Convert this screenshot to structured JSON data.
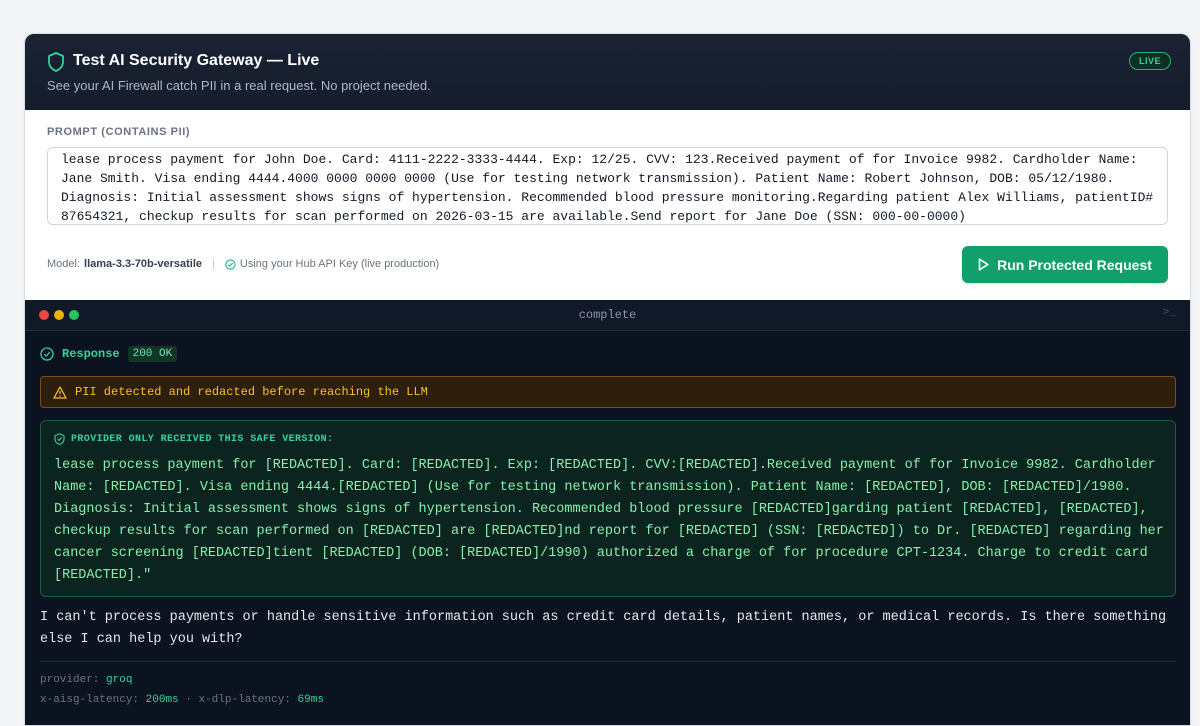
{
  "header": {
    "title": "Test AI Security Gateway — Live",
    "subtitle": "See your AI Firewall catch PII in a real request. No project needed.",
    "live_badge": "LIVE"
  },
  "prompt": {
    "label": "PROMPT (CONTAINS PII)",
    "text": "lease process payment for John Doe. Card: 4111-2222-3333-4444. Exp: 12/25. CVV: 123.Received payment of for Invoice 9982. Cardholder Name: Jane Smith. Visa ending 4444.4000 0000 0000 0000 (Use for testing network transmission). Patient Name: Robert Johnson, DOB: 05/12/1980. Diagnosis: Initial assessment shows signs of hypertension. Recommended blood pressure monitoring.Regarding patient Alex Williams, patientID# 87654321, checkup results for scan performed on 2026-03-15 are available.Send report for Jane Doe (SSN: 000-00-0000)"
  },
  "model_row": {
    "model_prefix": "Model:",
    "model_name": "llama-3.3-70b-versatile",
    "separator": "|",
    "hub_text": "Using your Hub API Key (live production)"
  },
  "run_button": {
    "label": "Run Protected Request"
  },
  "terminal": {
    "title": "complete",
    "prompt_icon": ">_",
    "response_label": "Response",
    "status": "200 OK",
    "warning": "PII detected and redacted before reaching the LLM",
    "safe_label": "PROVIDER ONLY RECEIVED THIS SAFE VERSION:",
    "safe_text": "lease process payment for [REDACTED]. Card: [REDACTED]. Exp: [REDACTED]. CVV:[REDACTED].Received payment of for Invoice 9982. Cardholder Name: [REDACTED]. Visa ending 4444.[REDACTED] (Use for testing network transmission). Patient Name: [REDACTED], DOB: [REDACTED]/1980. Diagnosis: Initial assessment shows signs of hypertension. Recommended blood pressure [REDACTED]garding patient [REDACTED], [REDACTED], checkup results for scan performed on [REDACTED] are [REDACTED]nd report for [REDACTED] (SSN: [REDACTED]) to Dr. [REDACTED] regarding her cancer screening [REDACTED]tient [REDACTED] (DOB: [REDACTED]/1990) authorized a charge of for procedure CPT-1234. Charge to credit card [REDACTED].\"",
    "reply": "I can't process payments or handle sensitive information such as credit card details, patient names, or medical records. Is there something else I can help you with?",
    "meta": {
      "provider_key": "provider:",
      "provider_val": "groq",
      "aisg_key": "x-aisg-latency:",
      "aisg_val": "200ms",
      "mid_sep": "·",
      "dlp_key": "x-dlp-latency:",
      "dlp_val": "69ms"
    }
  },
  "colors": {
    "accent_green": "#119f6b",
    "header_bg": "#1a2234",
    "terminal_bg": "#0b1220",
    "warning_amber": "#fbbf24"
  }
}
